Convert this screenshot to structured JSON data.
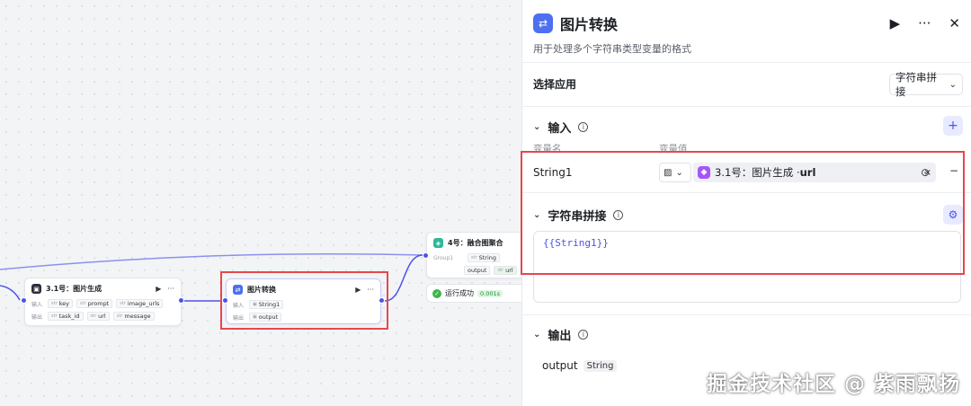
{
  "canvas": {
    "node_image_gen": {
      "title": "3.1号：图片生成",
      "input_label": "输入",
      "output_label": "输出",
      "inputs": [
        "key",
        "prompt",
        "image_urls"
      ],
      "outputs": [
        "task_id",
        "url",
        "message"
      ]
    },
    "node_convert": {
      "title": "图片转换",
      "input_label": "输入",
      "output_label": "输出",
      "inputs": [
        "String1"
      ],
      "outputs": [
        "output"
      ]
    },
    "node_merge": {
      "title": "4号：融合图聚合",
      "group_label": "Group1",
      "chips": [
        "String",
        "output",
        "url"
      ]
    },
    "run_status": {
      "text": "运行成功",
      "time": "0.001s"
    }
  },
  "panel": {
    "title": "图片转换",
    "description": "用于处理多个字符串类型变量的格式",
    "select_app_label": "选择应用",
    "select_app_value": "字符串拼接",
    "input_section": {
      "title": "输入",
      "col_name": "变量名",
      "col_value": "变量值",
      "var_name": "String1",
      "ref_text": "3.1号：图片生成 · ",
      "ref_field": "url"
    },
    "concat_section": {
      "title": "字符串拼接",
      "template": "{{String1}}"
    },
    "output_section": {
      "title": "输出",
      "var_name": "output",
      "var_type": "String"
    }
  },
  "watermark": "掘金技术社区 @ 紫雨飘扬",
  "colors": {
    "accent": "#4d53e8",
    "highlight": "#e5484d",
    "success": "#3cb64a",
    "ref_icon": "#a855f7"
  },
  "icons": [
    "play-icon",
    "more-icon",
    "close-icon",
    "chevron-down-icon",
    "info-icon",
    "plus-icon",
    "settings-icon",
    "image-type-icon",
    "clear-icon",
    "variable-icon",
    "minus-icon"
  ]
}
